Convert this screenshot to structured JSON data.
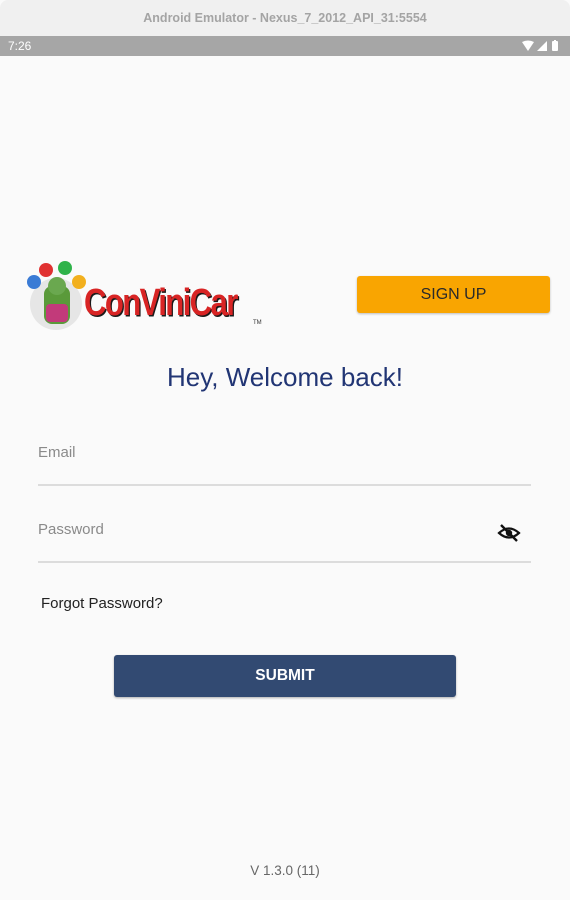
{
  "window": {
    "title": "Android Emulator - Nexus_7_2012_API_31:5554"
  },
  "status_bar": {
    "time": "7:26"
  },
  "logo": {
    "text": "ConViniCar",
    "tm": "TM"
  },
  "buttons": {
    "sign_up": "SIGN UP",
    "submit": "SUBMIT"
  },
  "welcome": "Hey, Welcome back!",
  "form": {
    "email_placeholder": "Email",
    "password_placeholder": "Password"
  },
  "forgot_password": "Forgot Password?",
  "version": "V 1.3.0 (11)",
  "colors": {
    "accent_orange": "#f9a501",
    "primary_navy": "#324a72",
    "heading_blue": "#213574",
    "logo_red": "#d82424"
  }
}
